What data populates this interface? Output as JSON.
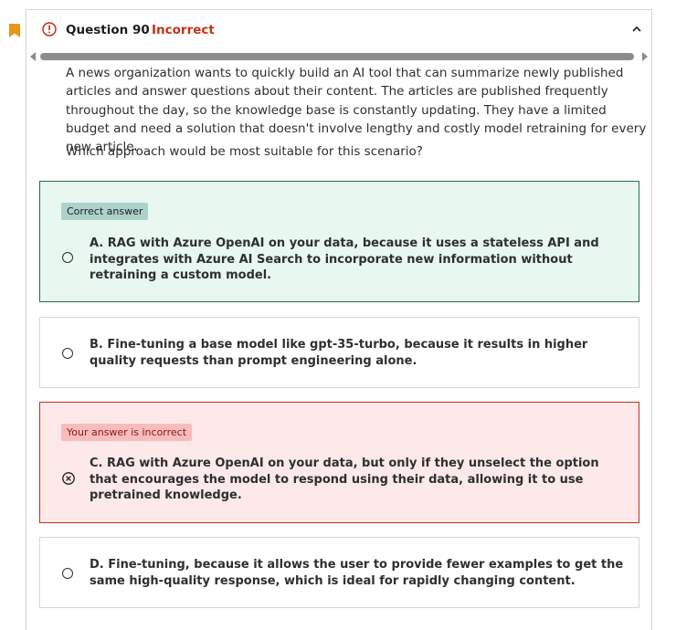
{
  "header": {
    "question_label": "Question 90",
    "status": "Incorrect"
  },
  "prompt": "A news organization wants to quickly build an AI tool that can summarize newly published articles and answer questions about their content. The articles are published frequently throughout the day, so the knowledge base is constantly updating. They have a limited budget and need a solution that doesn't involve lengthy and costly model retraining for every new article.",
  "question": "Which approach would be most suitable for this scenario?",
  "options": [
    {
      "text": "A. RAG with Azure OpenAI on your data, because it uses a stateless API and integrates with Azure AI Search to incorporate new information without retraining a custom model.",
      "badge": "Correct answer"
    },
    {
      "text": "B. Fine-tuning a base model like gpt-35-turbo, because it results in higher quality requests than prompt engineering alone."
    },
    {
      "text": "C. RAG with Azure OpenAI on your data, but only if they unselect the option that encourages the model to respond using their data, allowing it to use pretrained knowledge.",
      "badge": "Your answer is incorrect"
    },
    {
      "text": "D. Fine-tuning, because it allows the user to provide fewer examples to get the same high-quality response, which is ideal for rapidly changing content."
    }
  ],
  "colors": {
    "incorrect": "#c4301a",
    "correct_bg": "#e8f7f0",
    "correct_border": "#1e6f4f",
    "wrong_bg": "#fde9e9",
    "bookmark": "#e59819"
  }
}
